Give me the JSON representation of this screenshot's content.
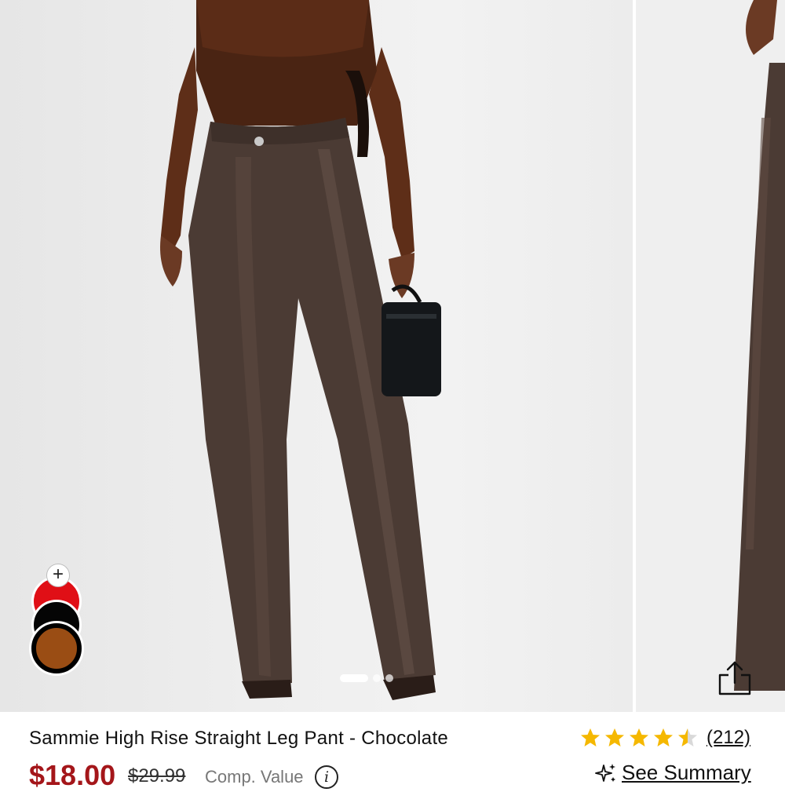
{
  "product": {
    "title": "Sammie High Rise Straight Leg Pant - Chocolate",
    "price": "$18.00",
    "compare_price": "$29.99",
    "compare_label": "Comp. Value",
    "info_icon": "i"
  },
  "rating": {
    "value": 4.5,
    "max": 5,
    "count_label": "(212)",
    "star_color": "#f5b800"
  },
  "summary": {
    "label": "See Summary",
    "icon": "sparkle-icon"
  },
  "swatches": {
    "add_label": "+",
    "colors": [
      "#e00f16",
      "#050505",
      "#9a4d14"
    ],
    "selected": 2
  },
  "gallery": {
    "slides": 3,
    "active_slide": 0
  },
  "icons": {
    "share": "share-icon",
    "info": "info-icon"
  },
  "colors": {
    "price": "#a4161a",
    "garment": "#4b3b34",
    "top": "#5b2c17"
  }
}
